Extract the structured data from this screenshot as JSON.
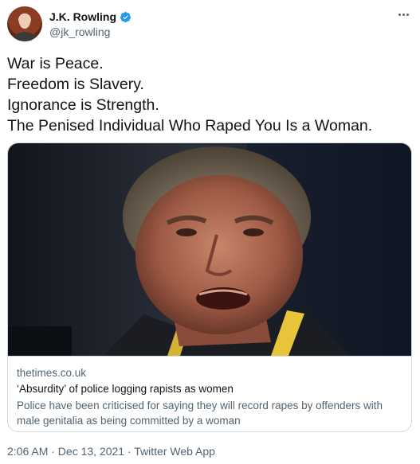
{
  "author": {
    "display_name": "J.K. Rowling",
    "handle": "@jk_rowling",
    "verified": true,
    "avatar_icon": "profile-photo"
  },
  "more_icon": "more-options-icon",
  "tweet_lines": [
    "War is Peace.",
    "Freedom is Slavery.",
    "Ignorance is Strength.",
    "The Penised Individual Who Raped You Is a Woman."
  ],
  "link_card": {
    "image": "photo-of-man-speaking",
    "domain": "thetimes.co.uk",
    "title": "‘Absurdity’ of police logging rapists as women",
    "description": "Police have been criticised for saying they will record rapes by offenders with male genitalia as being committed by a woman"
  },
  "meta": {
    "timestamp_line": "2:06 AM · Dec 13, 2021 · Twitter Web App"
  },
  "colors": {
    "text_primary": "#0f1419",
    "text_secondary": "#536471",
    "verified_blue": "#1d9bf0",
    "border": "#cfd9de"
  }
}
